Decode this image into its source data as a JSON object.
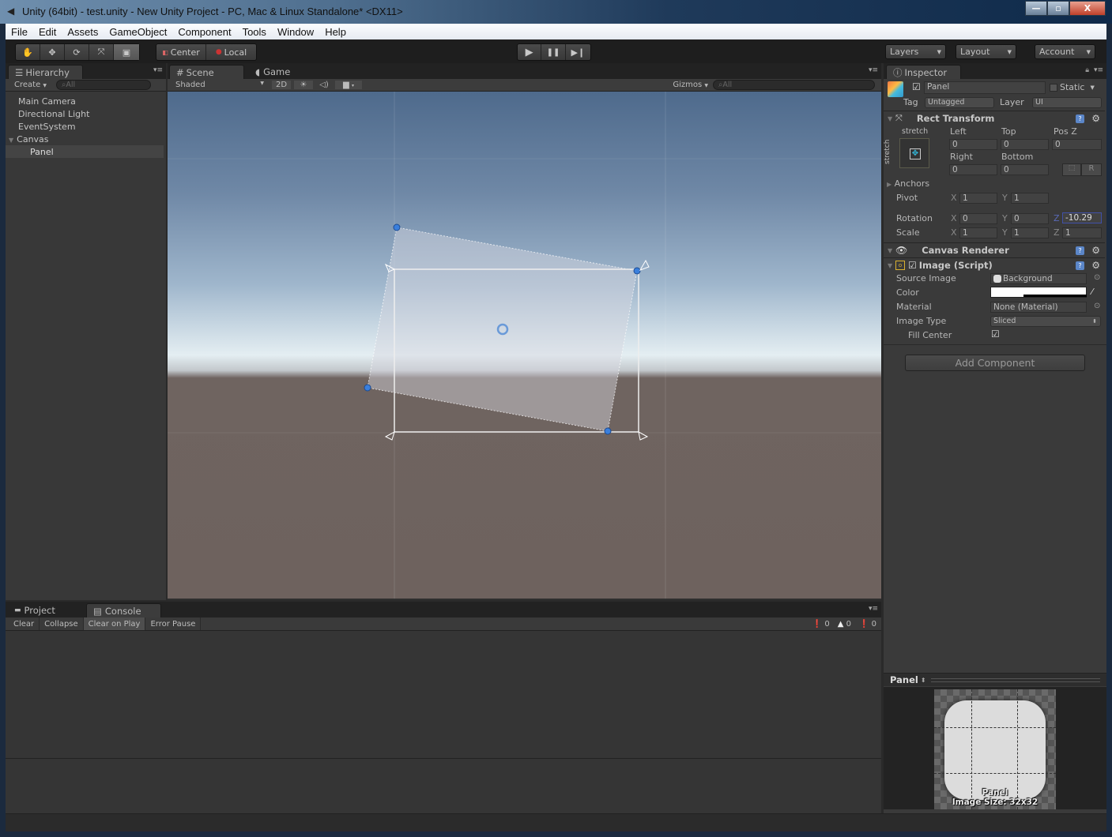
{
  "window": {
    "title": "Unity (64bit) - test.unity - New Unity Project - PC, Mac & Linux Standalone* <DX11>",
    "controls": {
      "minimize": "—",
      "maximize": "▫",
      "close": "X"
    }
  },
  "menu": [
    "File",
    "Edit",
    "Assets",
    "GameObject",
    "Component",
    "Tools",
    "Window",
    "Help"
  ],
  "toolbar": {
    "tools": [
      {
        "name": "hand-tool",
        "glyph": "✋"
      },
      {
        "name": "move-tool",
        "glyph": "✥"
      },
      {
        "name": "rotate-tool",
        "glyph": "⟳"
      },
      {
        "name": "scale-tool",
        "glyph": "⤧"
      },
      {
        "name": "rect-tool",
        "glyph": "▣"
      }
    ],
    "pivot_mode": "Center",
    "pivot_space": "Local",
    "play": "▶",
    "pause": "❚❚",
    "step": "▶❙",
    "layers": "Layers",
    "layout": "Layout",
    "account": "Account"
  },
  "hierarchy": {
    "tab": "Hierarchy",
    "create": "Create",
    "search_placeholder": "All",
    "items": [
      {
        "label": "Main Camera",
        "depth": 0
      },
      {
        "label": "Directional Light",
        "depth": 0
      },
      {
        "label": "EventSystem",
        "depth": 0
      },
      {
        "label": "Canvas",
        "depth": 0,
        "expanded": true
      },
      {
        "label": "Panel",
        "depth": 1,
        "selected": true
      }
    ]
  },
  "scene": {
    "tabs": [
      "Scene",
      "Game"
    ],
    "shading": "Shaded",
    "mode_2d": "2D",
    "gizmos": "Gizmos",
    "search_placeholder": "All"
  },
  "inspector": {
    "tab": "Inspector",
    "object_name": "Panel",
    "active": true,
    "static_label": "Static",
    "tag_label": "Tag",
    "tag": "Untagged",
    "layer_label": "Layer",
    "layer": "UI",
    "rect_transform": {
      "title": "Rect Transform",
      "anchor_preset_h": "stretch",
      "anchor_preset_v": "stretch",
      "left_label": "Left",
      "top_label": "Top",
      "posz_label": "Pos Z",
      "right_label": "Right",
      "bottom_label": "Bottom",
      "left": "0",
      "top": "0",
      "pos_z": "0",
      "right": "0",
      "bottom": "0",
      "raw_button": "R",
      "anchors": "Anchors",
      "pivot_label": "Pivot",
      "pivot_x": "1",
      "pivot_y": "1",
      "rotation_label": "Rotation",
      "rot_x": "0",
      "rot_y": "0",
      "rot_z": "-10.29",
      "scale_label": "Scale",
      "scale_x": "1",
      "scale_y": "1",
      "scale_z": "1"
    },
    "canvas_renderer": {
      "title": "Canvas Renderer"
    },
    "image": {
      "title": "Image (Script)",
      "enabled": true,
      "source_image_label": "Source Image",
      "source_image": "Background",
      "color_label": "Color",
      "color": "#ffffff",
      "material_label": "Material",
      "material": "None (Material)",
      "image_type_label": "Image Type",
      "image_type": "Sliced",
      "fill_center_label": "Fill Center",
      "fill_center": true
    },
    "add_component": "Add Component",
    "preview": {
      "title": "Panel",
      "name": "Panel",
      "size": "Image Size: 32x32"
    }
  },
  "bottom": {
    "tabs": [
      "Project",
      "Console"
    ],
    "active_tab": "Console",
    "buttons": [
      "Clear",
      "Collapse",
      "Clear on Play",
      "Error Pause"
    ],
    "active_button": "Clear on Play",
    "counts": {
      "info": "0",
      "warnings": "0",
      "errors": "0"
    }
  }
}
